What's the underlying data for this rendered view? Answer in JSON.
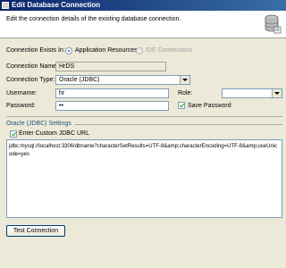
{
  "window": {
    "title": "Edit Database Connection"
  },
  "header": {
    "description": "Edit the connection details of the existing database connection."
  },
  "connection_exists_in": {
    "label": "Connection Exists In:",
    "options": [
      "Application Resources",
      "IDE Connections"
    ],
    "selected": "Application Resources"
  },
  "form": {
    "connection_name_label": "Connection Name:",
    "connection_name_value": "HrDS",
    "connection_type_label": "Connection Type:",
    "connection_type_value": "Oracle (JDBC)",
    "username_label": "Username:",
    "username_value": "hr",
    "role_label": "Role:",
    "role_value": "",
    "password_label": "Password:",
    "password_value": "••",
    "save_password_label": "Save Password",
    "save_password_checked": true
  },
  "settings": {
    "section_title": "Oracle (JDBC) Settings",
    "custom_url_label": "Enter Custom JDBC URL",
    "custom_url_checked": true,
    "jdbc_url": "jdbc:mysql://localhost:3306/dbname?characterSetResults=UTF-8&amp;characterEncoding=UTF-8&amp;useUnicode=yes"
  },
  "actions": {
    "test_connection_label": "Test Connection"
  },
  "icons": {
    "title": "window-icon",
    "header": "database-icon"
  },
  "colors": {
    "titlebar": "#0a246a",
    "dialog_bg": "#ece9d8",
    "accent": "#1c5180",
    "check": "#21a121"
  }
}
